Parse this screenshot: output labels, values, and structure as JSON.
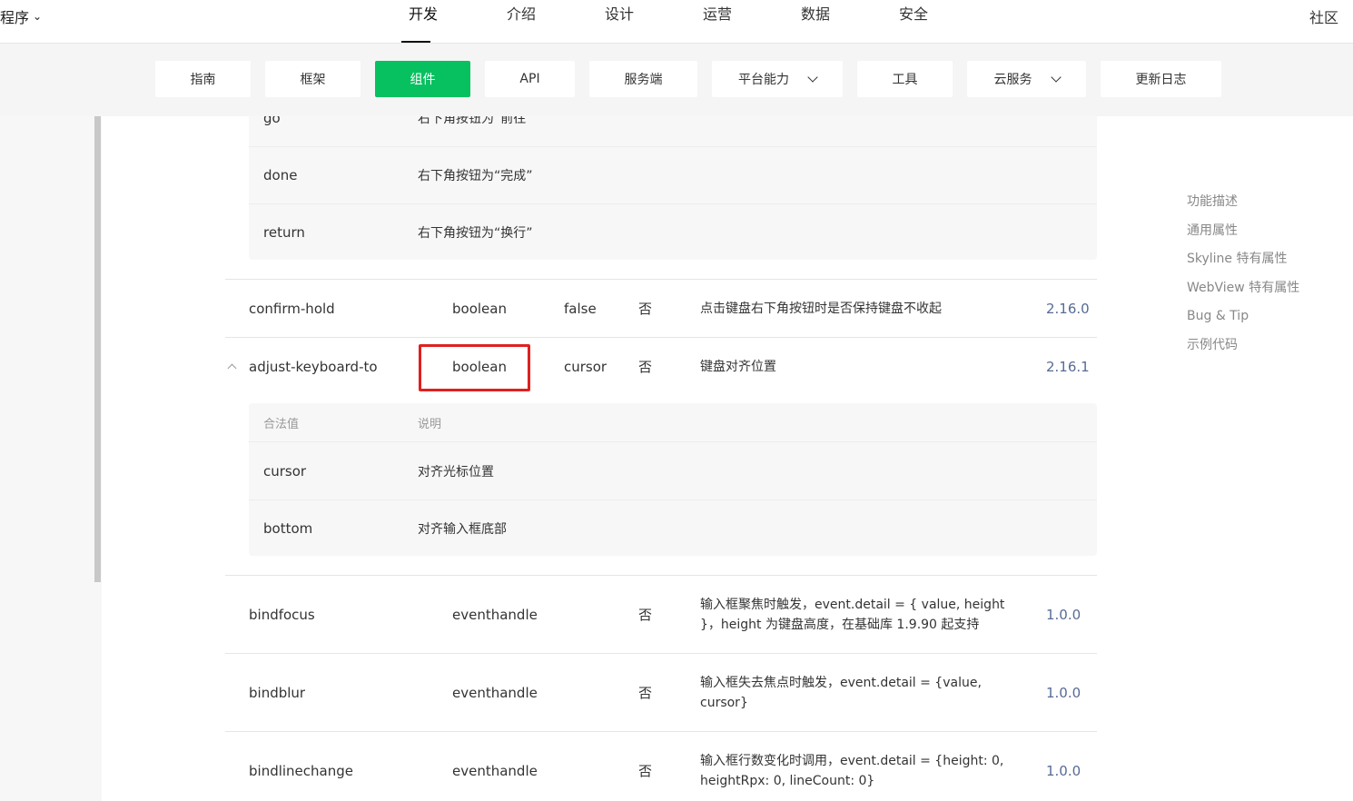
{
  "topnav": {
    "brand": "程序",
    "tabs": [
      "开发",
      "介绍",
      "设计",
      "运营",
      "数据",
      "安全"
    ],
    "active_tab": "开发",
    "community": "社区"
  },
  "subnav": {
    "items": [
      {
        "label": "指南"
      },
      {
        "label": "框架"
      },
      {
        "label": "组件"
      },
      {
        "label": "API"
      },
      {
        "label": "服务端"
      },
      {
        "label": "平台能力"
      },
      {
        "label": "工具"
      },
      {
        "label": "云服务"
      },
      {
        "label": "更新日志"
      }
    ],
    "active": "组件",
    "accent_color": "#07c160"
  },
  "table": {
    "confirm_type_values": [
      {
        "value": "go",
        "desc": "右下角按钮为“前往”"
      },
      {
        "value": "done",
        "desc": "右下角按钮为“完成”"
      },
      {
        "value": "return",
        "desc": "右下角按钮为“换行”"
      }
    ],
    "rows": [
      {
        "name": "confirm-hold",
        "type": "boolean",
        "default": "false",
        "required": "否",
        "desc": "点击键盘右下角按钮时是否保持键盘不收起",
        "version": "2.16.0"
      },
      {
        "name": "adjust-keyboard-to",
        "type": "boolean",
        "default": "cursor",
        "required": "否",
        "desc": "键盘对齐位置",
        "version": "2.16.1"
      },
      {
        "name": "bindfocus",
        "type": "eventhandle",
        "default": "",
        "required": "否",
        "desc": "输入框聚焦时触发，event.detail = { value, height }，height 为键盘高度，在基础库 1.9.90 起支持",
        "version": "1.0.0"
      },
      {
        "name": "bindblur",
        "type": "eventhandle",
        "default": "",
        "required": "否",
        "desc": "输入框失去焦点时触发，event.detail = {value, cursor}",
        "version": "1.0.0"
      },
      {
        "name": "bindlinechange",
        "type": "eventhandle",
        "default": "",
        "required": "否",
        "desc": "输入框行数变化时调用，event.detail = {height: 0, heightRpx: 0, lineCount: 0}",
        "version": "1.0.0"
      }
    ],
    "adjust_subtable": {
      "header": {
        "value": "合法值",
        "desc": "说明"
      },
      "values": [
        {
          "value": "cursor",
          "desc": "对齐光标位置"
        },
        {
          "value": "bottom",
          "desc": "对齐输入框底部"
        }
      ]
    },
    "highlight_color": "#e02020"
  },
  "toc": {
    "items": [
      "功能描述",
      "通用属性",
      "Skyline 特有属性",
      "WebView 特有属性",
      "Bug & Tip",
      "示例代码"
    ]
  }
}
